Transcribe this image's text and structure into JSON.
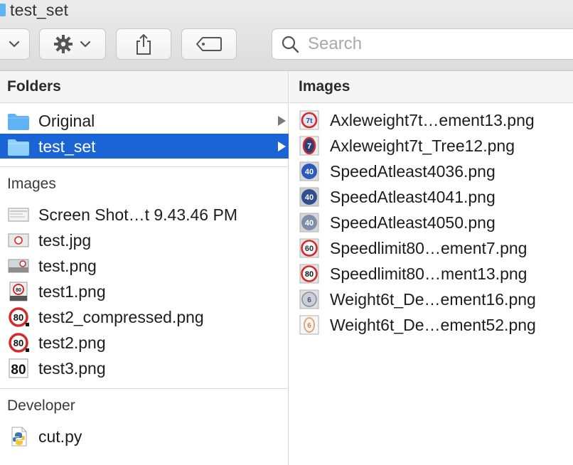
{
  "window": {
    "title": "test_set"
  },
  "toolbar": {
    "search_placeholder": "Search",
    "search_value": ""
  },
  "folders_pane": {
    "header": "Folders",
    "folders": [
      {
        "label": "Original",
        "selected": false
      },
      {
        "label": "test_set",
        "selected": true
      }
    ],
    "images_section": {
      "label": "Images",
      "items": [
        {
          "label": "Screen Shot…t 9.43.46 PM",
          "icon": "screenshot-thumb-icon"
        },
        {
          "label": "test.jpg",
          "icon": "image-thumb-icon"
        },
        {
          "label": "test.png",
          "icon": "image-thumb-icon"
        },
        {
          "label": "test1.png",
          "icon": "sign-80-thumb-icon"
        },
        {
          "label": "test2_compressed.png",
          "icon": "speed-limit-80-thumb-icon"
        },
        {
          "label": "test2.png",
          "icon": "speed-limit-80-thumb-icon"
        },
        {
          "label": "test3.png",
          "icon": "speed-limit-80-plain-thumb-icon"
        }
      ]
    },
    "developer_section": {
      "label": "Developer",
      "items": [
        {
          "label": "cut.py",
          "icon": "python-file-icon"
        }
      ]
    }
  },
  "images_pane": {
    "header": "Images",
    "items": [
      {
        "label": "Axleweight7t…ement13.png",
        "sign_text": "7t",
        "style": "red"
      },
      {
        "label": "Axleweight7t_Tree12.png",
        "sign_text": "7",
        "style": "red"
      },
      {
        "label": "SpeedAtleast4036.png",
        "sign_text": "40",
        "style": "blue"
      },
      {
        "label": "SpeedAtleast4041.png",
        "sign_text": "40",
        "style": "blue"
      },
      {
        "label": "SpeedAtleast4050.png",
        "sign_text": "40",
        "style": "gray"
      },
      {
        "label": "Speedlimit80…ement7.png",
        "sign_text": "60",
        "style": "red"
      },
      {
        "label": "Speedlimit80…ment13.png",
        "sign_text": "80",
        "style": "red"
      },
      {
        "label": "Weight6t_De…ement16.png",
        "sign_text": "6",
        "style": "gray"
      },
      {
        "label": "Weight6t_De…ement52.png",
        "sign_text": "6",
        "style": "pale"
      }
    ]
  },
  "colors": {
    "selection": "#1a64d6",
    "folder": "#5db3f3",
    "sign_red": "#d42a2a",
    "sign_blue": "#2a5bb8"
  }
}
